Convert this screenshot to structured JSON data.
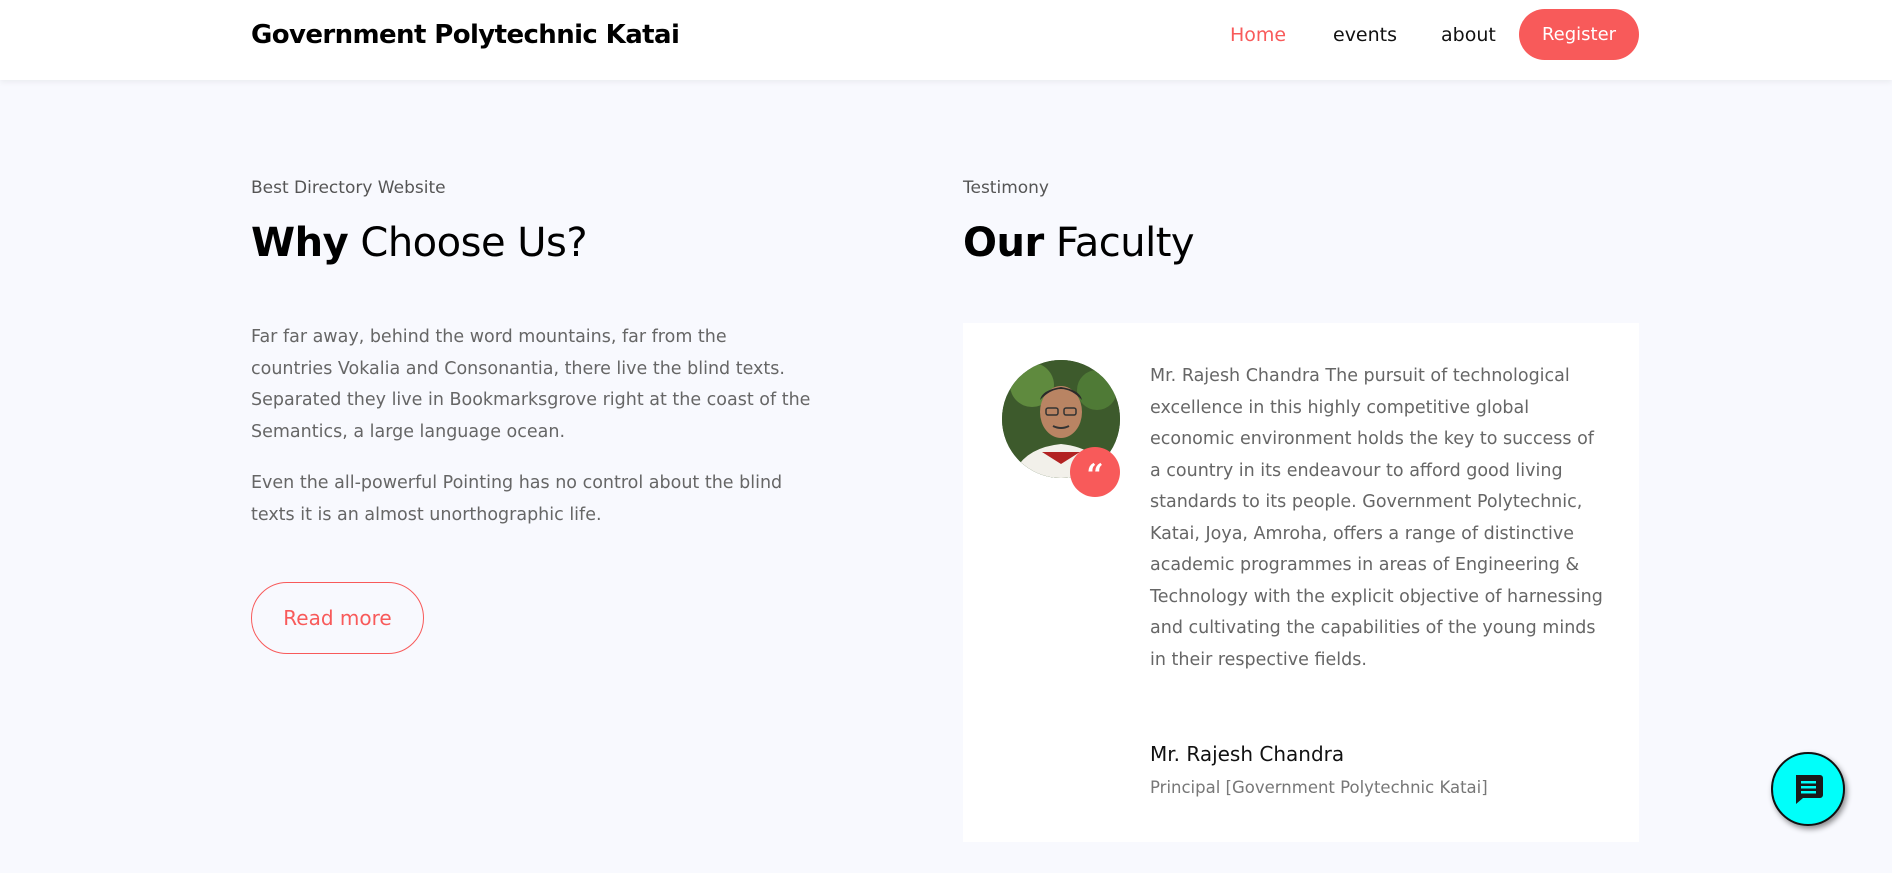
{
  "header": {
    "brand": "Government Polytechnic Katai",
    "nav": {
      "home": "Home",
      "events": "events",
      "about": "about"
    },
    "register_label": "Register",
    "accent_color": "#f85a5a"
  },
  "why": {
    "eyebrow": "Best Directory Website",
    "heading_bold": "Why",
    "heading_rest": " Choose Us?",
    "paragraph1": "Far far away, behind the word mountains, far from the countries Vokalia and Consonantia, there live the blind texts. Separated they live in Bookmarksgrove right at the coast of the Semantics, a large language ocean.",
    "paragraph2": "Even the all-powerful Pointing has no control about the blind texts it is an almost unorthographic life.",
    "read_more_label": "Read more"
  },
  "faculty": {
    "eyebrow": "Testimony",
    "heading_bold": "Our",
    "heading_rest": " Faculty",
    "quote_icon": "quote-icon",
    "text": "Mr. Rajesh Chandra The pursuit of technological excellence in this highly competitive global economic environment holds the key to success of a country in its endeavour to afford good living standards to its people. Government Polytechnic, Katai, Joya, Amroha, offers a range of distinctive academic programmes in areas of Engineering & Technology with the explicit objective of harnessing and cultivating the capabilities of the young minds in their respective fields.",
    "name": "Mr. Rajesh Chandra",
    "role": "Principal [Government Polytechnic Katai]"
  },
  "chat": {
    "icon": "chat-icon",
    "color": "#00fffa"
  }
}
